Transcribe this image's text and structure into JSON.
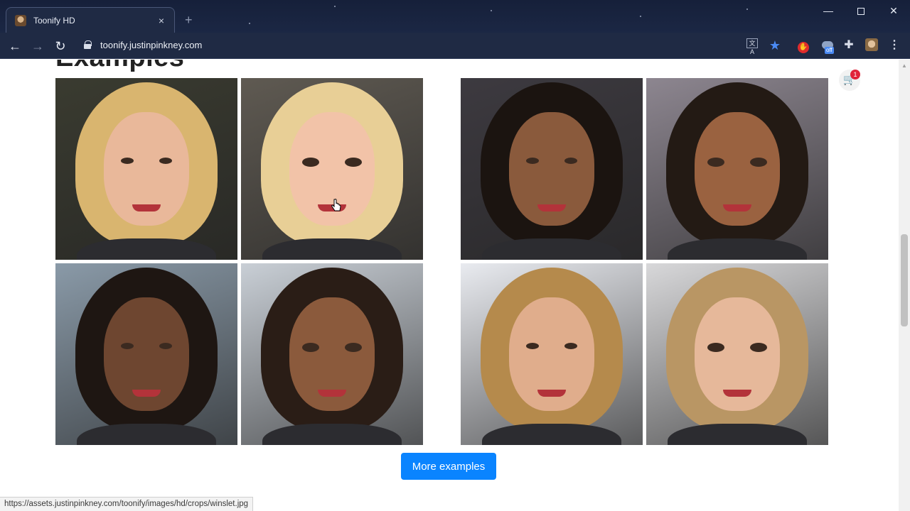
{
  "browser": {
    "tab_title": "Toonify HD",
    "tab_close": "×",
    "new_tab": "+",
    "url": "toonify.justinpinkney.com",
    "window_controls": {
      "minimize": "—",
      "maximize": "",
      "close": "✕"
    },
    "nav": {
      "back": "←",
      "forward": "→",
      "reload": "↻"
    },
    "extensions": {
      "translate": "文A",
      "bookmark": "★",
      "red_ext": "✋",
      "off_badge": "off",
      "puzzle": "✚",
      "menu": "⋮"
    },
    "status_url": "https://assets.justinpinkney.com/toonify/images/hd/crops/winslet.jpg"
  },
  "page": {
    "heading": "Examples",
    "cart_icon": "🛒",
    "cart_count": "1",
    "more_button": "More examples"
  },
  "photos": [
    {
      "id": "winslet-photo",
      "kind": "photo",
      "hair": "#d9b56f",
      "skin": "#e9b89a",
      "bg": "#3a3b30"
    },
    {
      "id": "winslet-toon",
      "kind": "toon",
      "hair": "#e8cf96",
      "skin": "#f2c3a8",
      "bg": "#5f5a52"
    },
    {
      "id": "smith-photo",
      "kind": "photo",
      "hair": "#1b1410",
      "skin": "#8a5a3c",
      "bg": "#3d3a40"
    },
    {
      "id": "smith-toon",
      "kind": "toon",
      "hair": "#231a14",
      "skin": "#9a6240",
      "bg": "#8d8690"
    },
    {
      "id": "saldana-photo",
      "kind": "photo",
      "hair": "#1e1612",
      "skin": "#6e4630",
      "bg": "#8a9aa8"
    },
    {
      "id": "saldana-toon",
      "kind": "toon",
      "hair": "#2a1d16",
      "skin": "#8b5a3c",
      "bg": "#c9cfd6"
    },
    {
      "id": "gosling-photo",
      "kind": "photo",
      "hair": "#b58a4c",
      "skin": "#e0ad8c",
      "bg": "#e9ebf0"
    },
    {
      "id": "gosling-toon",
      "kind": "toon",
      "hair": "#b99664",
      "skin": "#e6b89a",
      "bg": "#d8d8da"
    }
  ]
}
